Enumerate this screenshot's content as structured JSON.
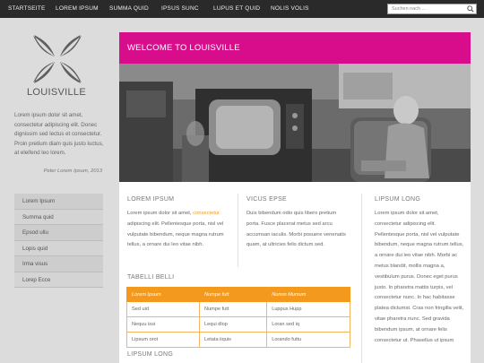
{
  "nav": {
    "items": [
      "STARTSEITE",
      "LOREM IPSUM",
      "SUMMA QUID",
      "IPSUS SUNC",
      "LUPUS ET QUID",
      "NOLIS VOLIS"
    ],
    "search_placeholder": "Suchen nach ..."
  },
  "brand": {
    "name": "LOUISVILLE",
    "quote": "Lorem ipsum dolor sit amet, consectetur adipiscing elit. Donec dignissim sed lectus et consectetur. Proin pretium diam quis justo luctus, at eleifend leo lorem.",
    "quote_author": "Peter Lorem Ipsum, 2013"
  },
  "sidebar": {
    "items": [
      "Lorem Ipsum",
      "Summa quid",
      "Epsod ullu",
      "Lopis quid",
      "Irma visus",
      "Lorep Ecce"
    ]
  },
  "main": {
    "banner_title": "WELCOME TO LOUISVILLE",
    "col1": {
      "heading": "LOREM IPSUM",
      "text_before": "Lorem ipsum dolor sit amet, ",
      "link": "consectetur",
      "text_after": " adipiscing elit. Pellentesque porta, nisl vel vulputate bibendum, neque magna rutrum tellus, a ornare dui leo vitae nibh."
    },
    "col2": {
      "heading": "VICUS EPSE",
      "text": "Duis bibendum odio quis libero pretium porta. Fusce placerat metus sed arcu accumsan iaculis. Morbi posuere venenatis quam, at ultricies felis dictum sed."
    },
    "col3": {
      "heading": "LIPSUM LONG",
      "text": "Lorem ipsum dolor sit amet, consectetur adipiscing elit. Pellentesque porta, nisl vel vulputate bibendum, neque magna rutrum tellus, a ornare dui leo vitae nibh. Morbi ac metus blandit, mollis magna a, vestibulum purus. Donec eget purus justo. In pharetra mattis turpis, vel consectetur nunc. In hac habitasse platea dictumst. Cras non fringilla velit, vitae pharetra nunc. Sed gravida bibendum ipsum, at ornare felis consectetur ut. Phasellus ut ipsum"
    },
    "table_heading": "TABELLI BELLI",
    "table": {
      "headers": [
        "Lorem Ipsum",
        "Numpe futt",
        "Nunon Mumum"
      ],
      "rows": [
        [
          "Sed uid",
          "Numpe futt",
          "Luppus Hupp"
        ],
        [
          "Nequu issi",
          "Lequi dlop",
          "Loran sed iq"
        ],
        [
          "Lipsum orot",
          "Letata iiquis",
          "Lorando futtu"
        ]
      ]
    },
    "bottom_heading": "LIPSUM LONG"
  },
  "colors": {
    "banner": "#d80d8c",
    "accent": "#f39a1e",
    "nav_bg": "#2a2a2a"
  }
}
